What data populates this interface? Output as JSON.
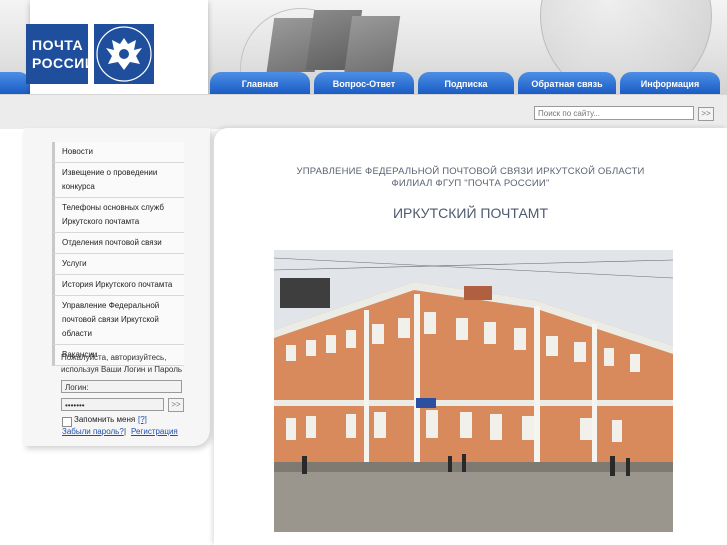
{
  "logo": {
    "text": "ПОЧТА РОССИИ"
  },
  "nav": {
    "items": [
      {
        "label": "Главная"
      },
      {
        "label": "Вопрос-Ответ"
      },
      {
        "label": "Подписка"
      },
      {
        "label": "Обратная связь"
      },
      {
        "label": "Информация"
      }
    ],
    "left_tab_icon": "menu-icon"
  },
  "search": {
    "placeholder": "Поиск по сайту...",
    "go_label": ">>"
  },
  "sidebar": {
    "items": [
      {
        "label": "Новости"
      },
      {
        "label": "Извещение о проведении конкурса"
      },
      {
        "label": "Телефоны основных служб Иркутского почтамта"
      },
      {
        "label": "Отделения почтовой связи"
      },
      {
        "label": "Услуги"
      },
      {
        "label": "История Иркутского почтамта"
      },
      {
        "label": "Управление Федеральной почтовой связи Иркутской области"
      },
      {
        "label": "Вакансии"
      }
    ]
  },
  "login": {
    "prompt": "Пожалуйста, авторизуйтесь, используя Ваши Логин и Пароль",
    "login_value": "Логин:",
    "password_value": "•••••••",
    "go_label": ">>",
    "remember_label": "Запомнить меня",
    "help_label": "[?]",
    "forgot_label": "Забыли пароль?",
    "separator": "|",
    "register_label": "Регистрация"
  },
  "main": {
    "org_line1": "УПРАВЛЕНИЕ ФЕДЕРАЛЬНОЙ ПОЧТОВОЙ СВЯЗИ ИРКУТСКОЙ ОБЛАСТИ",
    "org_line2": "ФИЛИАЛ ФГУП \"ПОЧТА РОССИИ\"",
    "title": "ИРКУТСКИЙ ПОЧТАМТ"
  },
  "colors": {
    "brand_blue": "#1f4f9c",
    "nav_blue": "#2a6fd6",
    "link_blue": "#1a4fb0"
  }
}
